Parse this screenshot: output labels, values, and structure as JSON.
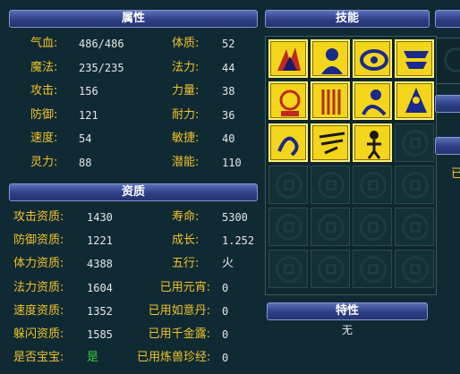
{
  "attributes": {
    "title": "属性",
    "rows": [
      {
        "l1": "气血:",
        "v1": "486/486",
        "l2": "体质:",
        "v2": "52"
      },
      {
        "l1": "魔法:",
        "v1": "235/235",
        "l2": "法力:",
        "v2": "44"
      },
      {
        "l1": "攻击:",
        "v1": "156",
        "l2": "力量:",
        "v2": "38"
      },
      {
        "l1": "防御:",
        "v1": "121",
        "l2": "耐力:",
        "v2": "36"
      },
      {
        "l1": "速度:",
        "v1": "54",
        "l2": "敏捷:",
        "v2": "40"
      },
      {
        "l1": "灵力:",
        "v1": "88",
        "l2": "潜能:",
        "v2": "110"
      }
    ]
  },
  "aptitude": {
    "title": "资质",
    "rows": [
      {
        "l1": "攻击资质:",
        "v1": "1430",
        "l2": "寿命:",
        "v2": "5300"
      },
      {
        "l1": "防御资质:",
        "v1": "1221",
        "l2": "成长:",
        "v2": "1.252"
      },
      {
        "l1": "体力资质:",
        "v1": "4388",
        "l2": "五行:",
        "v2": "火"
      },
      {
        "l1": "法力资质:",
        "v1": "1604",
        "l2": "已用元宵:",
        "v2": "0"
      },
      {
        "l1": "速度资质:",
        "v1": "1352",
        "l2": "已用如意丹:",
        "v2": "0"
      },
      {
        "l1": "躲闪资质:",
        "v1": "1585",
        "l2": "已用千金露:",
        "v2": "0"
      },
      {
        "l1": "是否宝宝:",
        "v1": "是",
        "l2": "已用炼兽珍经:",
        "v2": "0"
      }
    ]
  },
  "skills": {
    "title": "技能",
    "filled": [
      "skill-icon-1",
      "skill-icon-2",
      "skill-icon-3",
      "skill-icon-4",
      "skill-icon-5",
      "skill-icon-6",
      "skill-icon-7",
      "skill-icon-8",
      "skill-icon-9",
      "skill-icon-10",
      "skill-icon-11"
    ],
    "empty_icon": "empty-slot-icon",
    "slot_count": 24
  },
  "traits": {
    "title": "特性",
    "value": "无"
  },
  "right_panel": {
    "fragment_text": "已"
  },
  "colors": {
    "label": "#f0c22a",
    "value": "#e6e6e6",
    "bar": "#2e3f85",
    "skill_bg": "#f3d51c",
    "green": "#31d231"
  }
}
